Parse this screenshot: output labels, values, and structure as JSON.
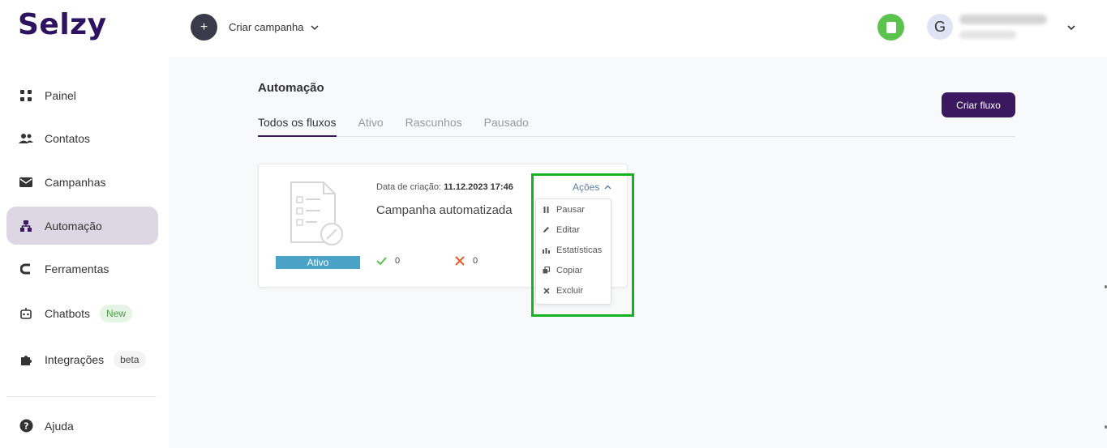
{
  "brand": {
    "name": "Selzy"
  },
  "header": {
    "create_campaign_label": "Criar campanha",
    "user_initial": "G"
  },
  "sidebar": {
    "items": [
      {
        "label": "Painel",
        "icon": "grid-icon"
      },
      {
        "label": "Contatos",
        "icon": "users-icon"
      },
      {
        "label": "Campanhas",
        "icon": "envelope-icon"
      },
      {
        "label": "Automação",
        "icon": "hierarchy-icon",
        "active": true
      },
      {
        "label": "Ferramentas",
        "icon": "magnet-icon"
      },
      {
        "label": "Chatbots",
        "icon": "robot-icon",
        "badge": "New"
      },
      {
        "label": "Integrações",
        "icon": "puzzle-icon",
        "badge": "beta"
      }
    ],
    "help_label": "Ajuda"
  },
  "main": {
    "title": "Automação",
    "create_flow_label": "Criar fluxo",
    "tabs": [
      {
        "label": "Todos os fluxos",
        "active": true
      },
      {
        "label": "Ativo"
      },
      {
        "label": "Rascunhos"
      },
      {
        "label": "Pausado"
      }
    ]
  },
  "flow_card": {
    "created_label": "Data de criação:",
    "created_value": "11.12.2023 17:46",
    "name": "Campanha automatizada",
    "status": "Ativo",
    "success_count": "0",
    "error_count": "0",
    "actions_label": "Ações",
    "actions_menu": [
      {
        "label": "Pausar",
        "icon": "pause-icon"
      },
      {
        "label": "Editar",
        "icon": "pencil-icon"
      },
      {
        "label": "Estatísticas",
        "icon": "bar-chart-icon"
      },
      {
        "label": "Copiar",
        "icon": "copy-icon"
      },
      {
        "label": "Excluir",
        "icon": "close-icon"
      }
    ]
  },
  "colors": {
    "brand": "#2e1460",
    "primary_button": "#3c1860",
    "active_nav": "#ddd6e3",
    "status_active": "#4aa3c7",
    "highlight": "#16b321",
    "success": "#5cc24e",
    "error": "#e65a2e"
  }
}
